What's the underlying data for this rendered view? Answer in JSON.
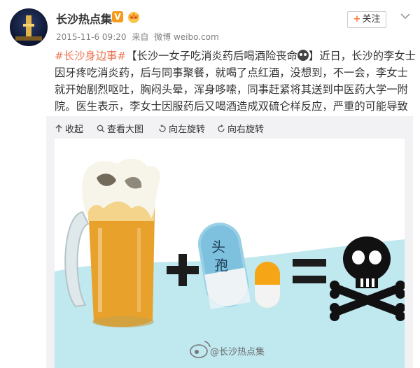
{
  "post": {
    "user_name": "长沙热点集",
    "verified_icon": "v-badge-icon",
    "verified_label": "V",
    "member_icon": "vip-crown-icon",
    "timestamp": "2015-11-6 09:20",
    "source_prefix": "来自",
    "source_name": "微博 weibo.com",
    "follow_label": "关注",
    "hashtag": "#长沙身边事#",
    "title": "【长沙一女子吃消炎药后喝酒险丧命",
    "title_close": "】",
    "body": "近日，长沙的李女士因牙疼吃消炎药，后与同事聚餐，就喝了点红酒，没想到，不一会，李女士就开始剧烈呕吐，胸闷头晕，浑身哆嗦，同事赶紧将其送到中医药大学一附院。医生表示，李女士因服药后又喝酒造成双硫仑样反应，严重的可能导致生命危险。"
  },
  "media": {
    "toolbar": {
      "collapse": "收起",
      "view_large": "查看大图",
      "rotate_left": "向左旋转",
      "rotate_right": "向右旋转"
    },
    "image": {
      "pill_text_1": "头",
      "pill_text_2": "孢",
      "plus": "+",
      "equals": "=",
      "watermark": "@长沙热点集"
    }
  },
  "colors": {
    "link": "#eb7350",
    "beer": "#e8a12a",
    "pill_blue": "#7ec1de",
    "pill_orange": "#f6a516",
    "water": "#bfe8ef"
  }
}
